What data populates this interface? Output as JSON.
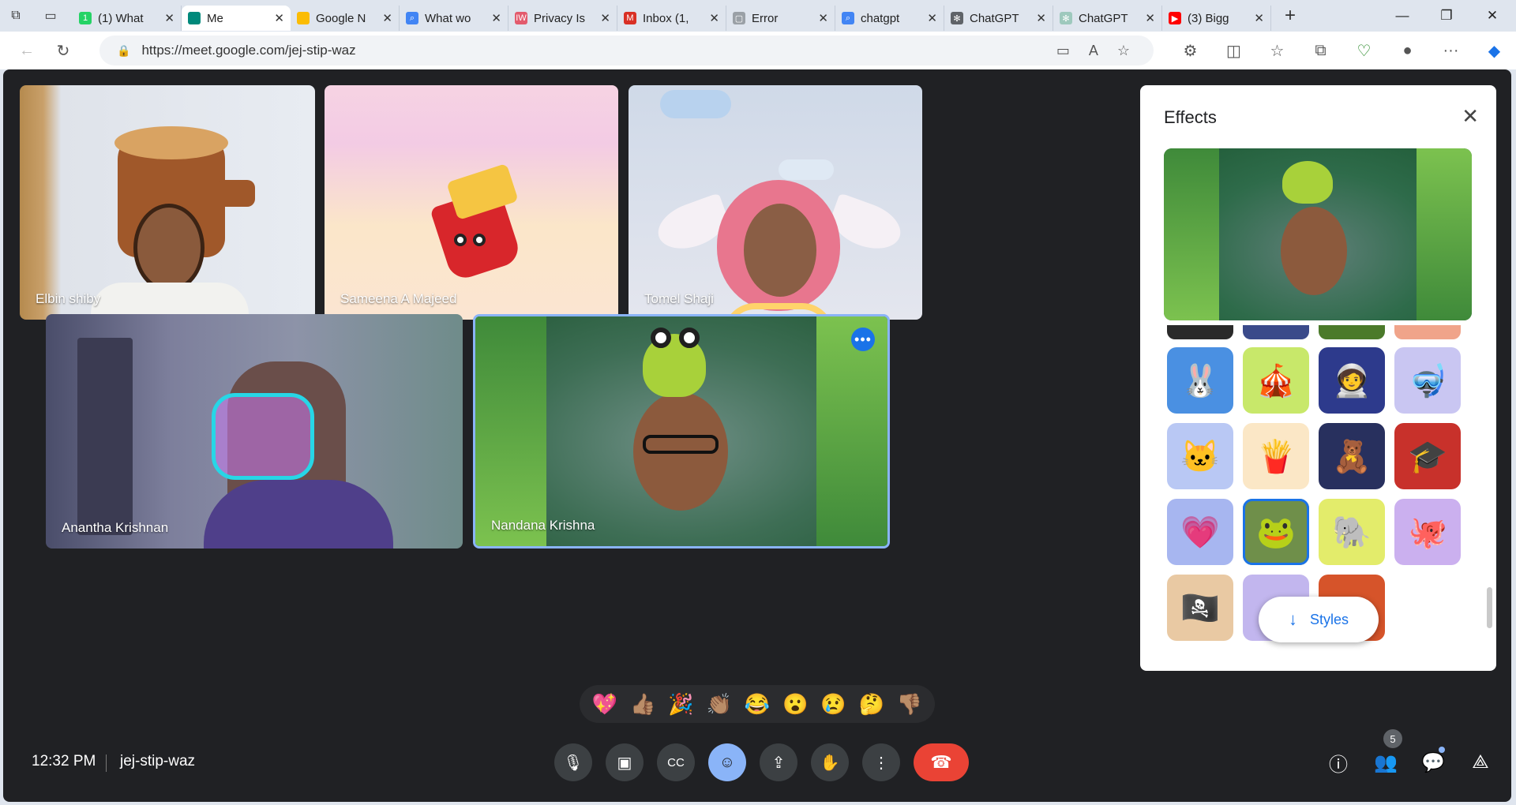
{
  "browser": {
    "tabs": [
      {
        "label": "(1) What",
        "favicon": "whatsapp-icon",
        "color": "#25d366",
        "glyph": "1"
      },
      {
        "label": "Me",
        "favicon": "meet-icon",
        "color": "#00897b",
        "glyph": "",
        "active": true
      },
      {
        "label": "Google N",
        "favicon": "meet-icon",
        "color": "#fbbc04",
        "glyph": ""
      },
      {
        "label": "What wo",
        "favicon": "search-icon",
        "color": "#4285f4",
        "glyph": "⌕"
      },
      {
        "label": "Privacy Is",
        "favicon": "iw-icon",
        "color": "#e35b6d",
        "glyph": "IW"
      },
      {
        "label": "Inbox (1,",
        "favicon": "gmail-icon",
        "color": "#d93025",
        "glyph": "M"
      },
      {
        "label": "Error",
        "favicon": "page-icon",
        "color": "#9aa0a6",
        "glyph": "▢"
      },
      {
        "label": "chatgpt",
        "favicon": "search-icon",
        "color": "#4285f4",
        "glyph": "⌕"
      },
      {
        "label": "ChatGPT",
        "favicon": "chatgpt-icon",
        "color": "#5f6368",
        "glyph": "✻"
      },
      {
        "label": "ChatGPT",
        "favicon": "chatgpt-icon",
        "color": "#9ec9bd",
        "glyph": "✻"
      },
      {
        "label": "(3) Bigg",
        "favicon": "youtube-icon",
        "color": "#ff0000",
        "glyph": "▶"
      }
    ],
    "url": "https://meet.google.com/jej-stip-waz"
  },
  "participants": [
    {
      "name": "Elbin shiby"
    },
    {
      "name": "Sameena A Majeed"
    },
    {
      "name": "Tomel Shaji"
    },
    {
      "name": "Anantha Krishnan"
    },
    {
      "name": "Nandana Krishna"
    }
  ],
  "effects": {
    "title": "Effects",
    "styles_label": "Styles",
    "items": [
      {
        "name": "bunny-effect",
        "emoji": "🐰",
        "bg": "#4a90e2"
      },
      {
        "name": "tent-effect",
        "emoji": "🎪",
        "bg": "#c8e86a"
      },
      {
        "name": "astronaut-effect",
        "emoji": "🧑‍🚀",
        "bg": "#2d3a8c"
      },
      {
        "name": "diver-effect",
        "emoji": "🤿",
        "bg": "#c9c6f2"
      },
      {
        "name": "cat-glasses-effect",
        "emoji": "🐱",
        "bg": "#b9c8f4"
      },
      {
        "name": "fries-effect",
        "emoji": "🍟",
        "bg": "#fbe7c6"
      },
      {
        "name": "sleeping-bear-effect",
        "emoji": "🧸",
        "bg": "#28305e"
      },
      {
        "name": "graduation-cap-effect",
        "emoji": "🎓",
        "bg": "#c8312b"
      },
      {
        "name": "heart-rainbow-effect",
        "emoji": "💗",
        "bg": "#a7b6f0"
      },
      {
        "name": "frog-effect",
        "emoji": "🐸",
        "bg": "#6f8f4a",
        "selected": true
      },
      {
        "name": "elephant-effect",
        "emoji": "🐘",
        "bg": "#e3ec6b"
      },
      {
        "name": "octopus-effect",
        "emoji": "🐙",
        "bg": "#cbb0ef"
      },
      {
        "name": "pirate-effect",
        "emoji": "🏴‍☠️",
        "bg": "#e9c9a3"
      },
      {
        "name": "partial-effect-1",
        "emoji": "",
        "bg": "#c2b6ee"
      },
      {
        "name": "partial-effect-2",
        "emoji": "",
        "bg": "#d6542a"
      }
    ]
  },
  "reactions": [
    "💖",
    "👍🏽",
    "🎉",
    "👏🏽",
    "😂",
    "😮",
    "😢",
    "🤔",
    "👎🏽"
  ],
  "footer": {
    "time": "12:32 PM",
    "meeting_code": "jej-stip-waz",
    "people_count": "5"
  }
}
